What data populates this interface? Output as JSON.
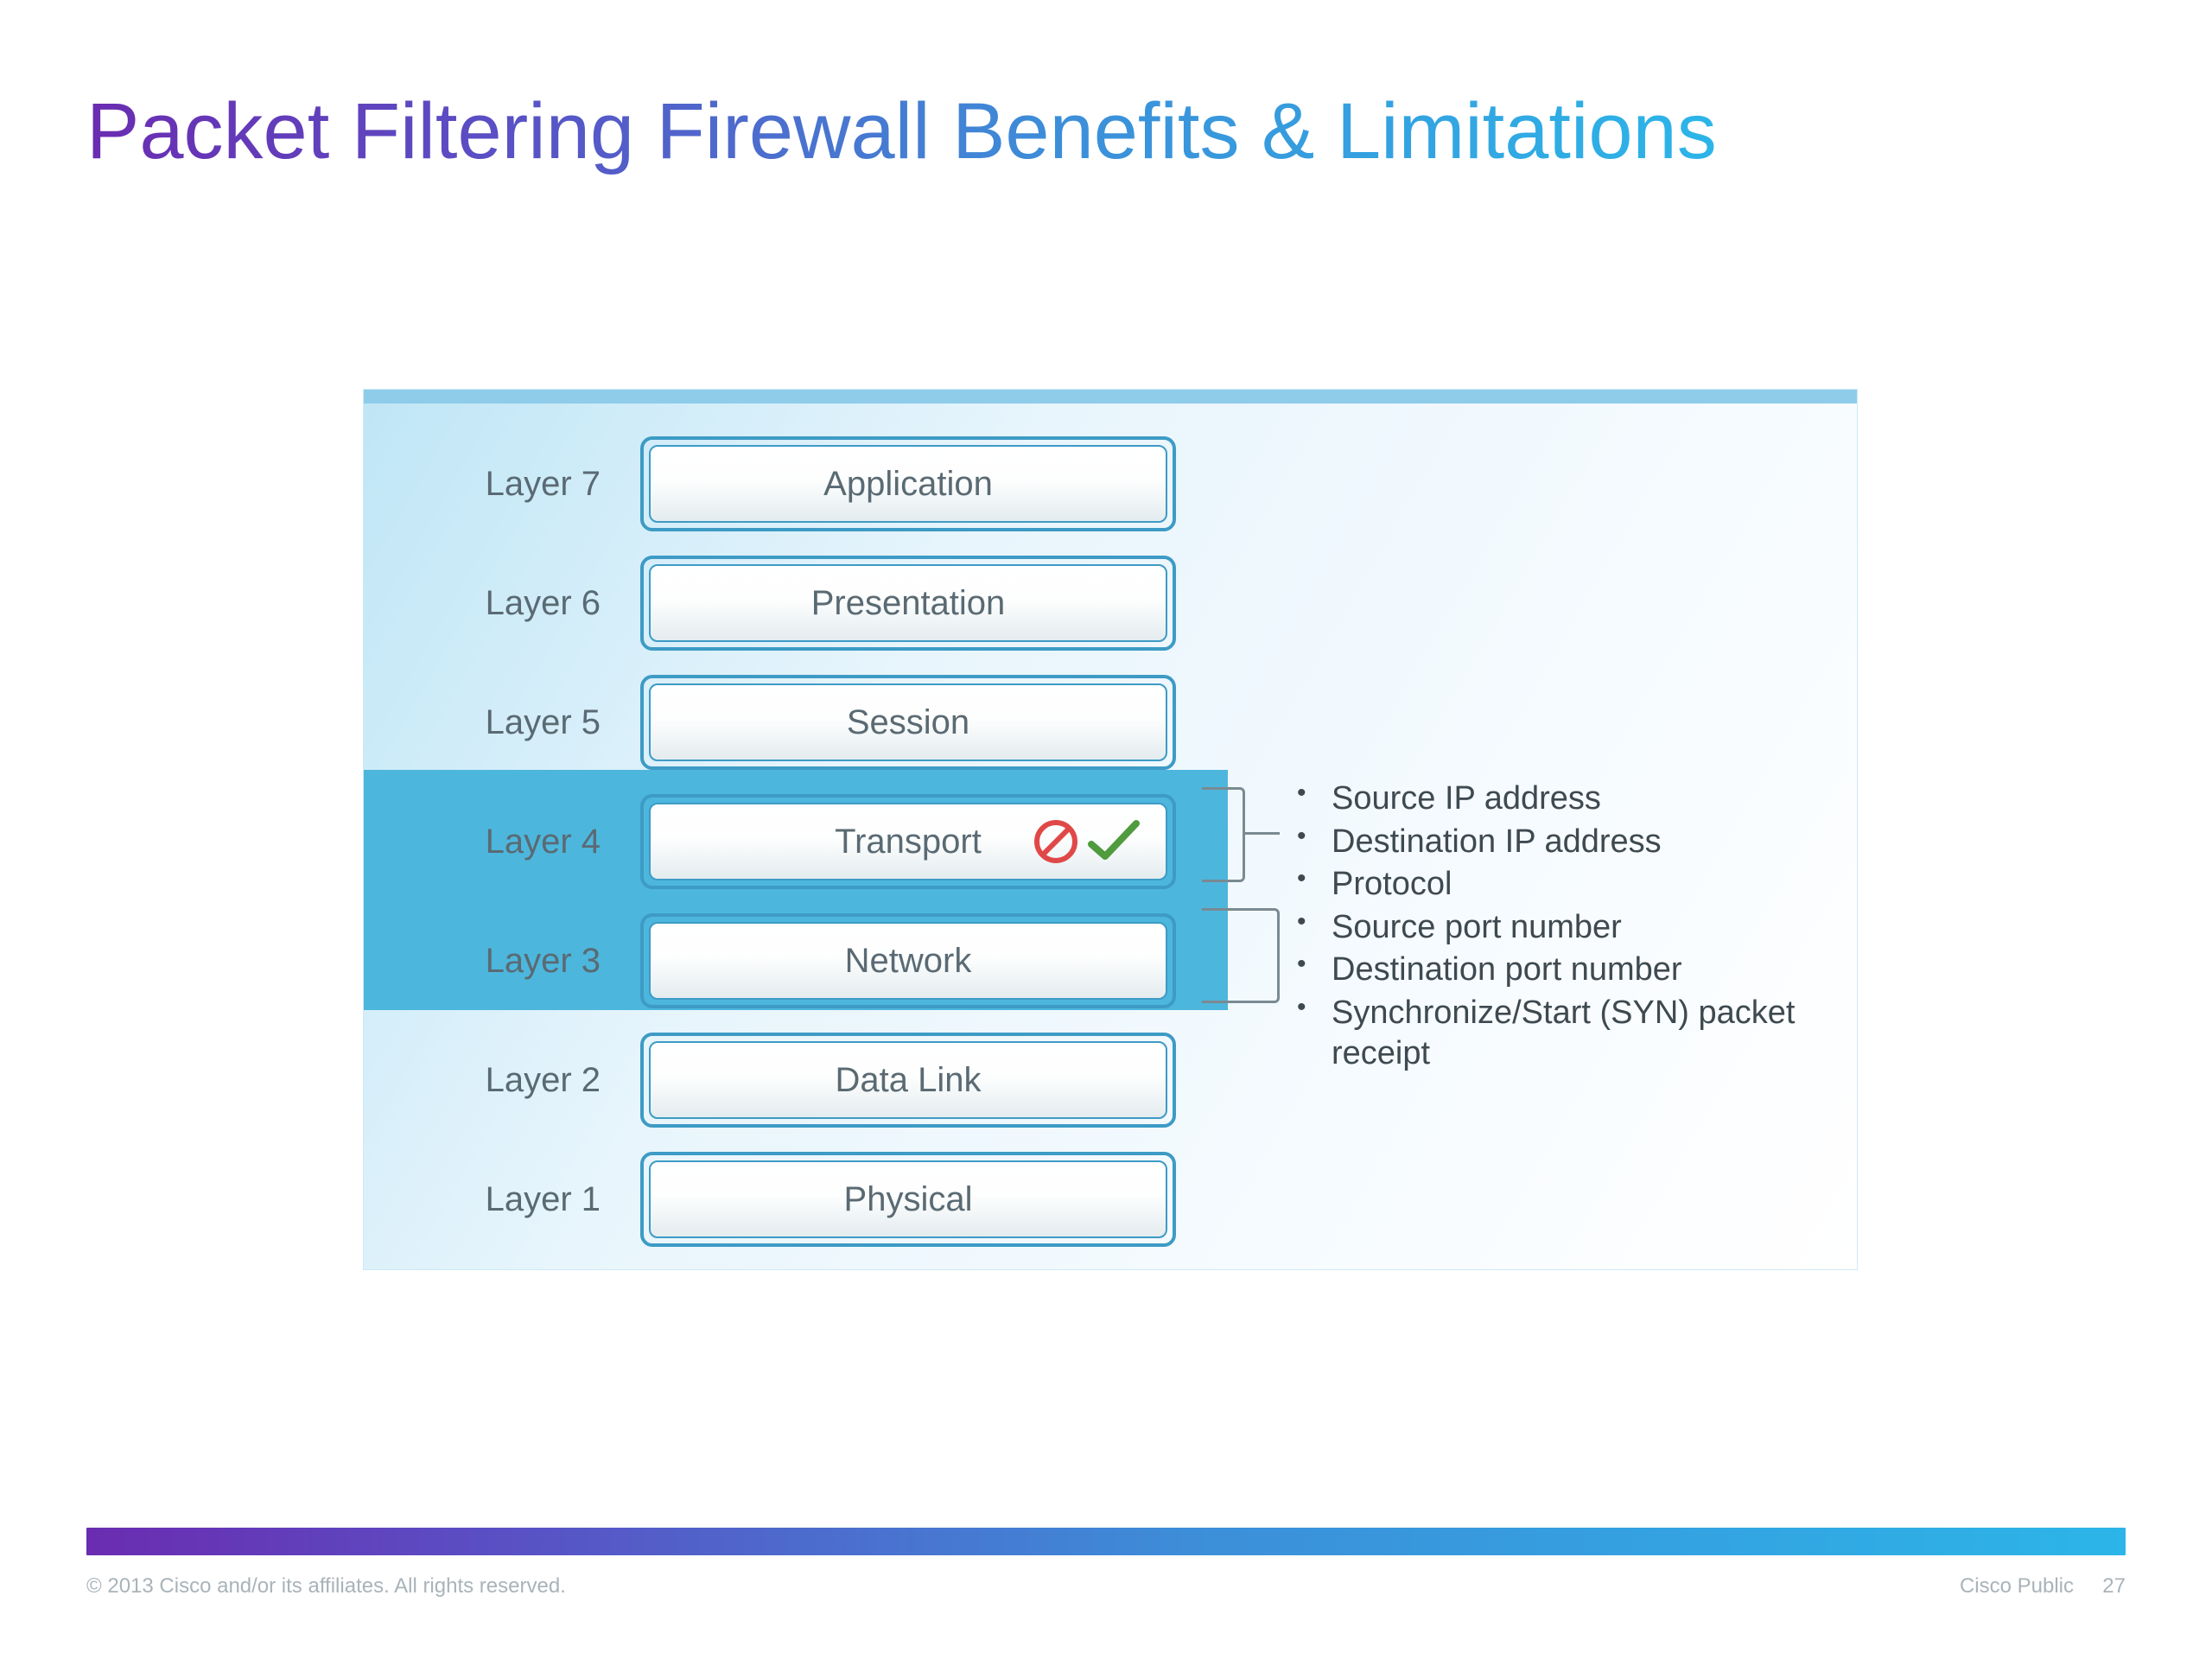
{
  "title": "Packet Filtering Firewall Benefits & Limitations",
  "layers": [
    {
      "label": "Layer 7",
      "name": "Application",
      "highlighted": false,
      "icons": false
    },
    {
      "label": "Layer 6",
      "name": "Presentation",
      "highlighted": false,
      "icons": false
    },
    {
      "label": "Layer 5",
      "name": "Session",
      "highlighted": false,
      "icons": false
    },
    {
      "label": "Layer 4",
      "name": "Transport",
      "highlighted": true,
      "icons": true
    },
    {
      "label": "Layer 3",
      "name": "Network",
      "highlighted": true,
      "icons": false
    },
    {
      "label": "Layer 2",
      "name": "Data Link",
      "highlighted": false,
      "icons": false
    },
    {
      "label": "Layer 1",
      "name": "Physical",
      "highlighted": false,
      "icons": false
    }
  ],
  "bullets": [
    "Source IP address",
    "Destination IP address",
    "Protocol",
    "Source port number",
    "Destination port number",
    "Synchronize/Start (SYN) packet receipt"
  ],
  "footer": {
    "copyright": "© 2013 Cisco and/or its affiliates. All rights reserved.",
    "classification": "Cisco Public",
    "page": "27"
  },
  "colors": {
    "title_gradient_start": "#6a2cb1",
    "title_gradient_end": "#2cb5e8",
    "highlight": "#4db6dd",
    "box_border": "#3d9bc5"
  }
}
